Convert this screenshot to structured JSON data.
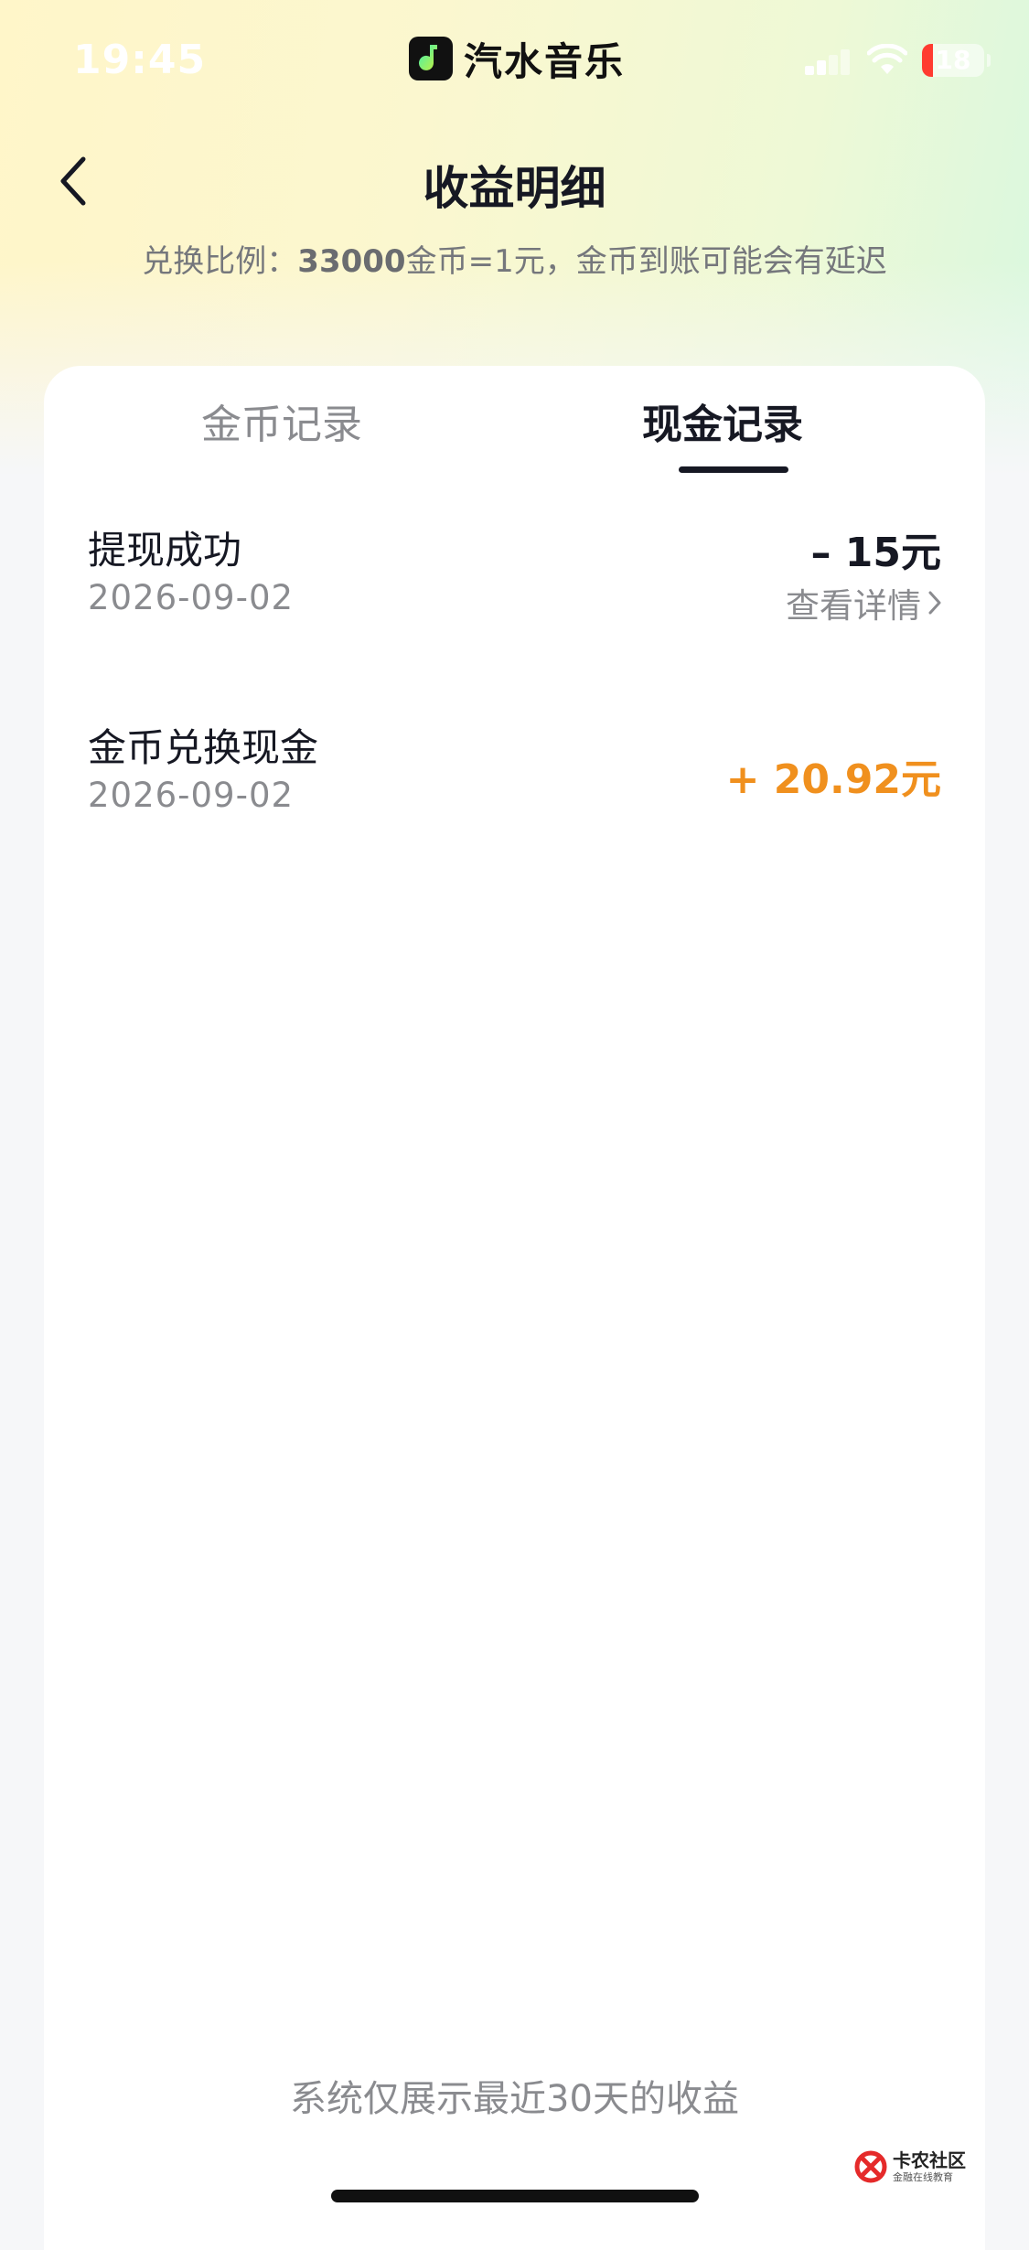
{
  "status_bar": {
    "time": "19:45",
    "app_name": "汽水音乐",
    "battery_level": "18"
  },
  "header": {
    "title": "收益明细",
    "back_icon": "chevron-left-icon",
    "subtitle_prefix": "兑换比例：",
    "subtitle_rate": "33000",
    "subtitle_suffix": "金币=1元，金币到账可能会有延迟"
  },
  "tabs": [
    {
      "label": "金币记录",
      "active": false
    },
    {
      "label": "现金记录",
      "active": true
    }
  ],
  "records": [
    {
      "title": "提现成功",
      "date": "2026-09-02",
      "amount": "– 15元",
      "detail_label": "查看详情"
    },
    {
      "title": "金币兑换现金",
      "date": "2026-09-02",
      "amount": "+ 20.92元"
    }
  ],
  "footer": {
    "note": "系统仅展示最近30天的收益"
  },
  "watermark": {
    "name": "卡农社区",
    "sub": "金融在线教育"
  },
  "colors": {
    "positive_amount": "#f0901e",
    "text_primary": "#161823",
    "text_secondary": "#8a8b8f"
  }
}
